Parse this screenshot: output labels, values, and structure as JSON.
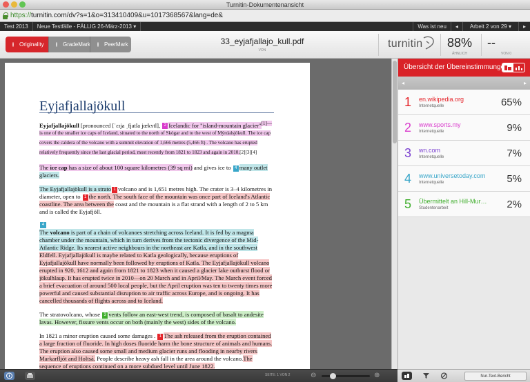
{
  "window": {
    "title": "Turnitin-Dokumentenansicht"
  },
  "browser": {
    "url_proto": "https://",
    "url_rest": "turnitin.com/dv?s=1&o=313410409&u=1017368567&lang=de&"
  },
  "nav": {
    "class": "Test 2013",
    "assignment": "Neue Testfälle - FÄLLIG 26-März-2013",
    "whatsnew": "Was ist neu",
    "prev": "◂",
    "paper": "Arbeit 2 von 29",
    "next": "▸"
  },
  "tabs": {
    "originality": "Originality",
    "grademark": "GradeMark",
    "peermark": "PeerMark"
  },
  "doc": {
    "filename": "33_eyjafjallajo_kull.pdf",
    "by": "VON"
  },
  "brand": {
    "name": "turnitin"
  },
  "score": {
    "value": "88%",
    "label": "ÄHNLICH",
    "other": "--",
    "other_label": "VON 0"
  },
  "paper": {
    "title": "Eyjafjallajökull",
    "m2": "2",
    "m4a": "4",
    "m1": "1",
    "m4b": "4",
    "m3": "3",
    "p1a": "Eyjafjallajökull",
    "p1b": " [pronounced [ˈɛɪja ˌfjatla jœkʏtl], ",
    "p1c": "Icelandic for \"island-mountain glacier\"",
    "p1d": "[1]—is one of the smaller ice caps of Iceland, situated to the north of Skógar and to the west of Mýrdalsjökull. The ice cap covers the caldera of the volcano with a summit elevation of 1,666 metres (5,466 ft) . The volcano has erupted relatively frequently since the last glacial period, most recently from 1821 to 1823 and again in 2010.",
    "p1e": "[2][3][4]",
    "p2a": "The ",
    "p2b": "ice cap",
    "p2c": " has a size of about 100 square kilometres (39 sq mi)",
    "p2d": " and gives ice to ",
    "p2e": "many outlet glaciers.",
    "p3a": "The Eyjafjallajökull is a strato",
    "p3b": "volcano and is 1,651 metres high. The crater is 3–4 kilometres in diameter, open to ",
    "p3c": "the north. The south face of the mountain was once part of Iceland's Atlantic coastline. The area between the",
    "p3d": " coast and the mountain is a flat strand with a length of 2 to 5 km and is called the Eyjafjöll.",
    "p4a": "The ",
    "p4b": "volcano",
    "p4c": " is part of a chain of volcanoes stretching across Iceland. It is fed by a magma chamber under the mountain, which in turn derives from the tectonic divergence of the Mid-Atlantic Ridge. Its nearest active neighbours in the northeast are Katla, and in the southwest",
    "p4d": " Eldfell. Eyjafjallajökull is maybe related to Katla geologically, because eruptions of Eyjafjallajökull have normally been followed by eruptions of Katla. The Eyjafjallajökull volcano erupted in 920, 1612 and again from 1821 to 1823 when it caused a glacier lake outburst flood or jökulhlaup. It has erupted twice in 2010—on 20 March and in April/May. The March event forced a brief evacuation of around 500 local people, but the April eruption was ten to twenty times more powerful and caused substantial disruption to air traffic across Europe, and is ongoing. It has cancelled thousands of flights across and to Iceland.",
    "p5a": "The stratovolcano, whose ",
    "p5b": "vents follow an east-west trend, is",
    "p5c": " composed of basalt to andesite lavas. However, fissure vents occur on both (mainly the west) sides of the volcano.",
    "p6a": "In 1821 a minor eruption caused some damages . ",
    "p6b": "The ash released from the eruption contained a large fraction of fluoride. In high doses fluoride harm the bone structure of animals and humans. The eruption also caused some small and medium glacier runs and flooding in nearby rivers Markarfljót and Holtsá.",
    "p6c": " People describe heavy ash fall in the area around the volcano.",
    "p6d": "The sequence of eruptions continued on a more subdued level until June 1822."
  },
  "panel": {
    "title": "Übersicht der Übereinstimmungen",
    "prev": "◂",
    "next": "▸",
    "matches": [
      {
        "num": "1",
        "source": "en.wikipedia.org",
        "type": "Internetquelle",
        "pct": "65%",
        "color": "#e5242a"
      },
      {
        "num": "2",
        "source": "www.sports.my",
        "type": "Internetquelle",
        "pct": "9%",
        "color": "#d93bcc"
      },
      {
        "num": "3",
        "source": "wn.com",
        "type": "Internetquelle",
        "pct": "7%",
        "color": "#7a3fd0"
      },
      {
        "num": "4",
        "source": "www.universetoday.com",
        "type": "Internetquelle",
        "pct": "5%",
        "color": "#38a6c9"
      },
      {
        "num": "5",
        "source": "Übermittelt an Hill-Mur…",
        "type": "Studentenarbeit",
        "pct": "2%",
        "color": "#3fae2c"
      }
    ]
  },
  "footer": {
    "page": "SEITE: 1 VON 2",
    "zoom_out": "⊖",
    "zoom_in": "⊕",
    "text_report": "Nur-Text-Bericht"
  }
}
